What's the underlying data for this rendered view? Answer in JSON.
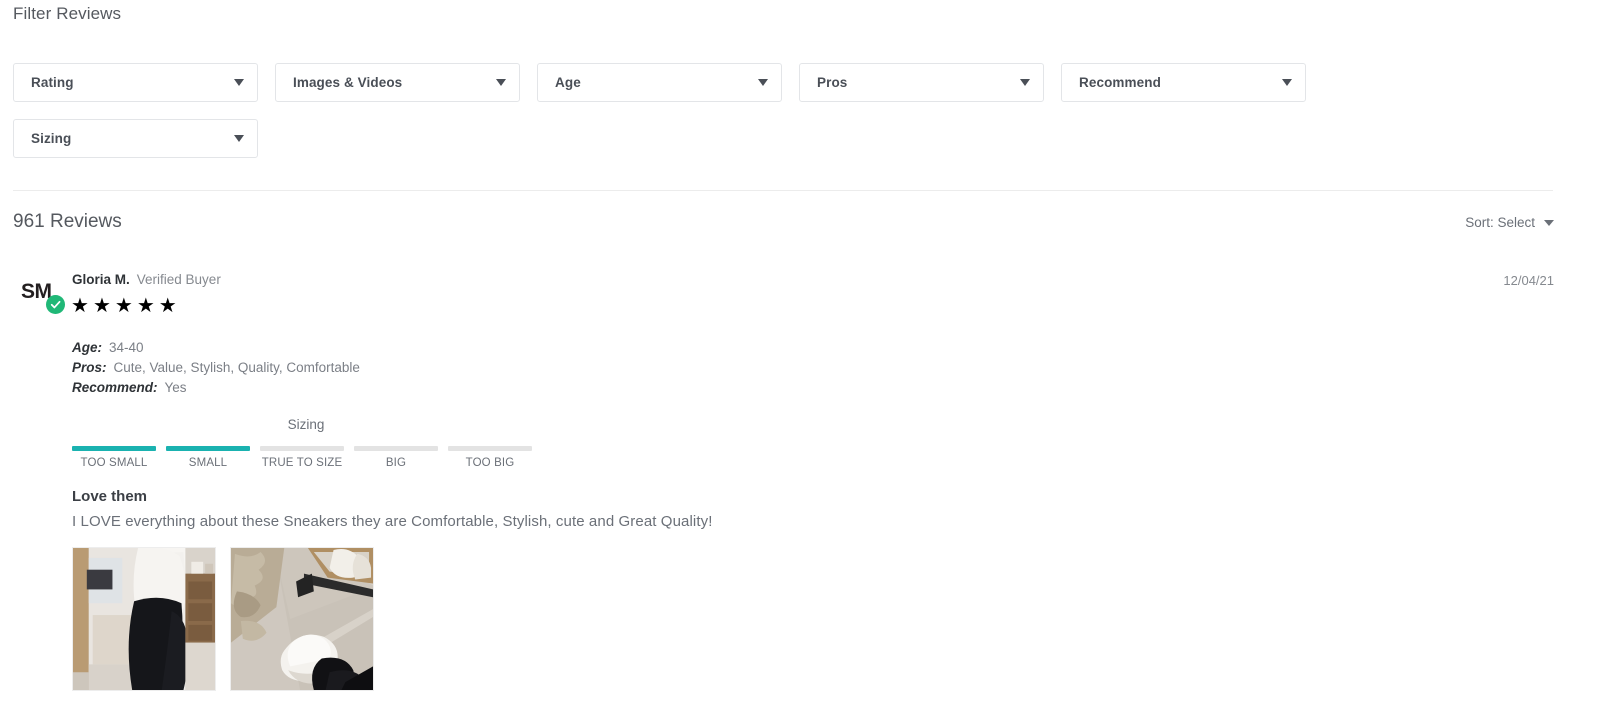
{
  "filter": {
    "title": "Filter Reviews",
    "dropdowns": [
      {
        "label": "Rating"
      },
      {
        "label": "Images & Videos"
      },
      {
        "label": "Age"
      },
      {
        "label": "Pros"
      },
      {
        "label": "Recommend"
      },
      {
        "label": "Sizing"
      }
    ]
  },
  "reviews_header": {
    "count_label": "961 Reviews",
    "sort_label": "Sort: Select"
  },
  "review": {
    "avatar_initials": "SM",
    "reviewer_name": "Gloria M.",
    "verified_text": "Verified Buyer",
    "date": "12/04/21",
    "stars_filled": 5,
    "stars_total": 5,
    "star_glyph": "★",
    "attributes": [
      {
        "key": "Age:",
        "value": "34-40"
      },
      {
        "key": "Pros:",
        "value": "Cute, Value, Stylish, Quality, Comfortable"
      },
      {
        "key": "Recommend:",
        "value": "Yes"
      }
    ],
    "sizing": {
      "title": "Sizing",
      "segments": [
        {
          "caption": "TOO SMALL",
          "filled": true
        },
        {
          "caption": "SMALL",
          "filled": true
        },
        {
          "caption": "TRUE TO SIZE",
          "filled": false
        },
        {
          "caption": "BIG",
          "filled": false
        },
        {
          "caption": "TOO BIG",
          "filled": false
        }
      ]
    },
    "title": "Love them",
    "body": "I LOVE everything about these Sneakers they are Comfortable, Stylish, cute and Great Quality!",
    "photos": [
      {
        "alt": "Mirror selfie wearing black leggings and white top"
      },
      {
        "alt": "White sneakers on tile floor near rug"
      }
    ]
  },
  "colors": {
    "sizing_filled": "#1ab2b0",
    "sizing_empty": "#e3e3e3",
    "verified_badge": "#20b877",
    "text_muted": "#6b7078",
    "text_dark": "#2f3337"
  }
}
